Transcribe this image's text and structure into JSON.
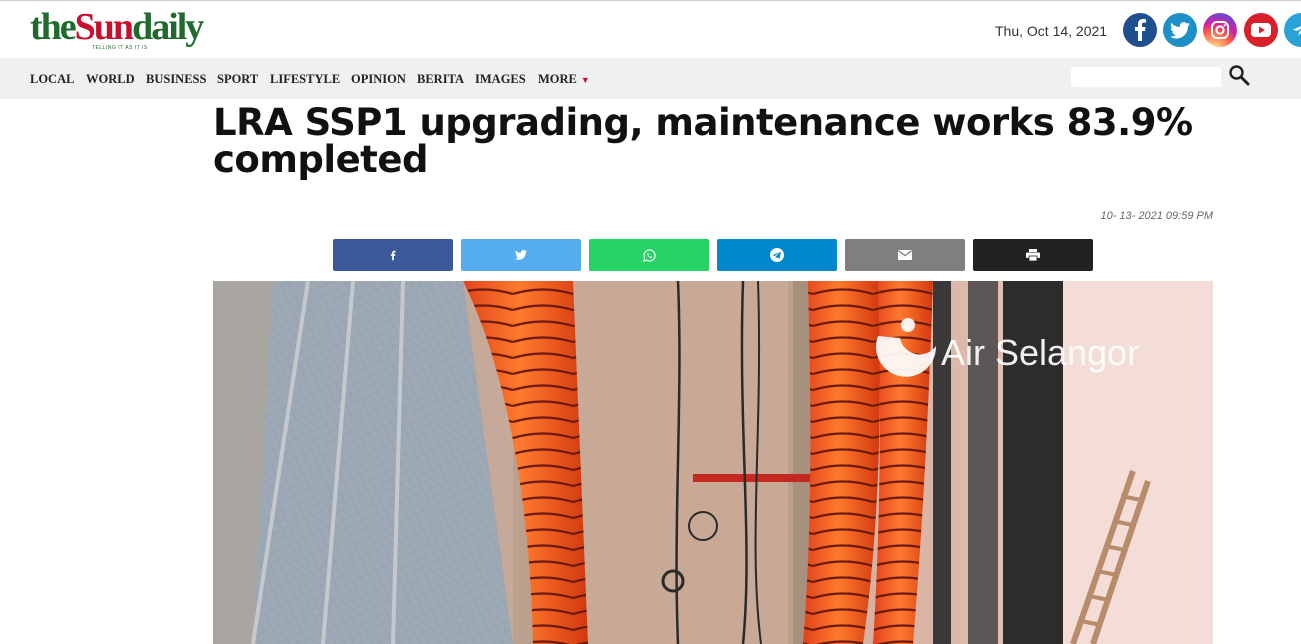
{
  "header": {
    "logo": {
      "part1": "the",
      "part2": "Sun",
      "part3": "daily",
      "tagline": "TELLING IT AS IT IS"
    },
    "date": "Thu, Oct 14, 2021",
    "social_icons": [
      "facebook-icon",
      "twitter-icon",
      "instagram-icon",
      "youtube-icon",
      "telegram-icon"
    ]
  },
  "nav": {
    "items": [
      "LOCAL",
      "WORLD",
      "BUSINESS",
      "SPORT",
      "LIFESTYLE",
      "OPINION",
      "BERITA",
      "IMAGES",
      "MORE"
    ],
    "more_arrow": "▼",
    "search_placeholder": ""
  },
  "article": {
    "headline": "LRA SSP1 upgrading, maintenance works 83.9% completed",
    "timestamp": "10- 13- 2021 09:59 PM",
    "share_buttons": [
      {
        "name": "facebook",
        "icon": "facebook-icon",
        "color": "#3b5998"
      },
      {
        "name": "twitter",
        "icon": "twitter-icon",
        "color": "#55acee"
      },
      {
        "name": "whatsapp",
        "icon": "whatsapp-icon",
        "color": "#25d366"
      },
      {
        "name": "telegram",
        "icon": "telegram-icon",
        "color": "#0088cc"
      },
      {
        "name": "email",
        "icon": "email-icon",
        "color": "#7f7f7f"
      },
      {
        "name": "print",
        "icon": "print-icon",
        "color": "#222222"
      }
    ],
    "photo_watermark": "Air Selangor"
  },
  "colors": {
    "brand_green": "#1f6a2c",
    "brand_red": "#c8102e",
    "nav_background": "#f0f0f0"
  }
}
